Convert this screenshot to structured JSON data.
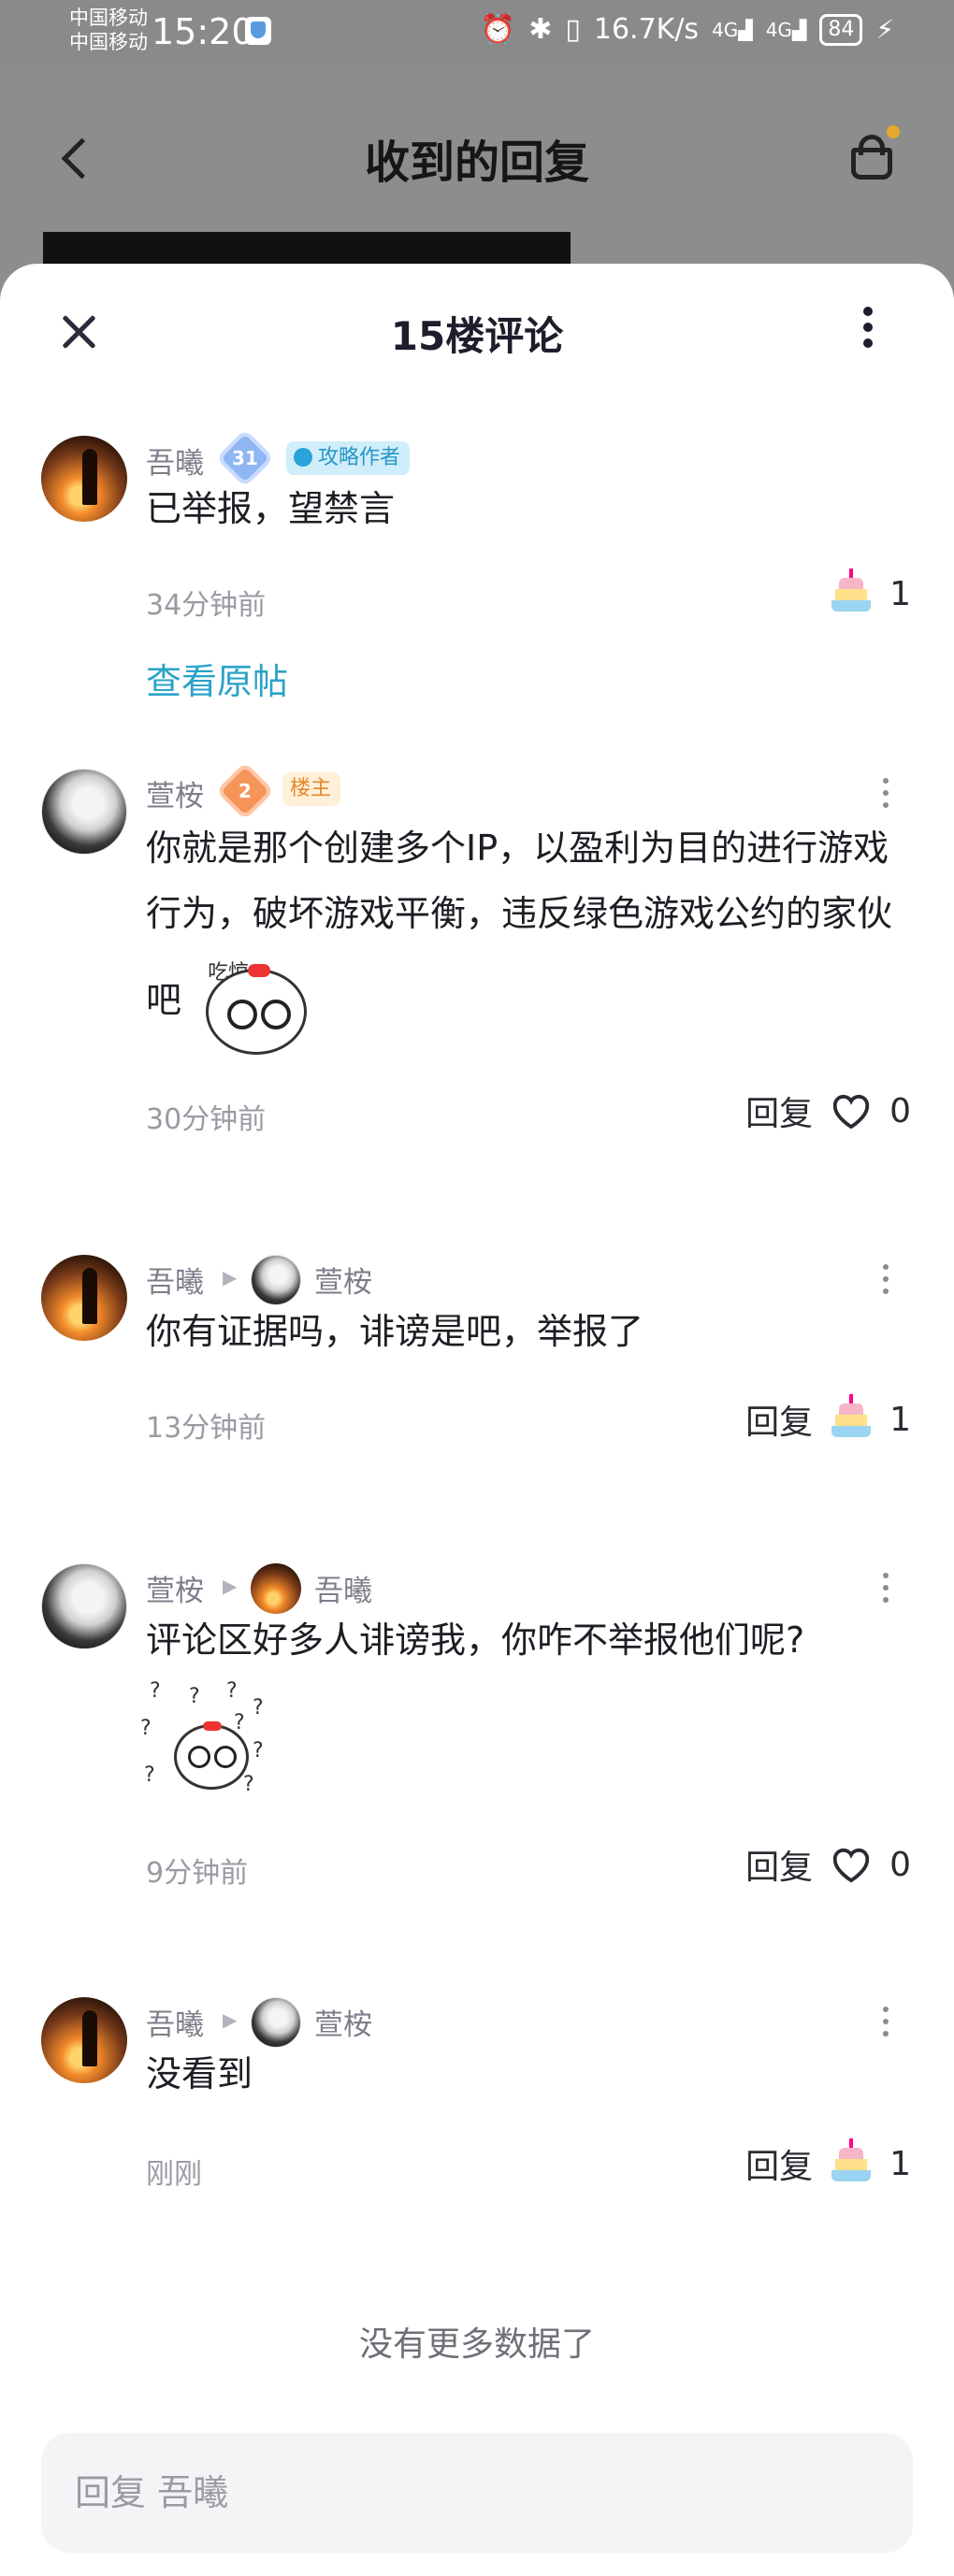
{
  "status_bar": {
    "carrier1": "中国移动",
    "carrier2": "中国移动",
    "time": "15:20",
    "net_speed": "16.7K/s",
    "signal1": "4G",
    "signal2": "4G",
    "battery": "84"
  },
  "page": {
    "title": "收到的回复"
  },
  "sheet": {
    "title": "15楼评论"
  },
  "main_comment": {
    "nickname": "吾曦",
    "level": "31",
    "tag": "攻略作者",
    "text": "已举报，望禁言",
    "time": "34分钟前",
    "cake_count": "1",
    "view_post_link": "查看原帖"
  },
  "replies": [
    {
      "nickname": "萱桉",
      "level": "2",
      "tag": "楼主",
      "text": "你就是那个创建多个IP，以盈利为目的进行游戏行为，破坏游戏平衡，违反绿色游戏公约的家伙吧",
      "sticker_text": "吃惊",
      "time": "30分钟前",
      "reply_label": "回复",
      "like_count": "0"
    },
    {
      "nickname": "吾曦",
      "reply_to": "萱桉",
      "text": "你有证据吗，诽谤是吧，举报了",
      "time": "13分钟前",
      "reply_label": "回复",
      "cake_count": "1"
    },
    {
      "nickname": "萱桉",
      "reply_to": "吾曦",
      "text": "评论区好多人诽谤我，你咋不举报他们呢?",
      "time": "9分钟前",
      "reply_label": "回复",
      "like_count": "0"
    },
    {
      "nickname": "吾曦",
      "reply_to": "萱桉",
      "text": "没看到",
      "time": "刚刚",
      "reply_label": "回复",
      "cake_count": "1"
    }
  ],
  "footer": {
    "no_more": "没有更多数据了",
    "reply_placeholder": "回复 吾曦"
  },
  "icons": {
    "back": "back-arrow-icon",
    "basket": "shopping-basket-icon",
    "close": "close-icon",
    "more": "more-vertical-icon",
    "heart": "heart-icon",
    "cake": "cake-icon"
  },
  "colors": {
    "link": "#2aa3c8",
    "overlay": "#8d8d8d",
    "tag_blue_text": "#2996c9",
    "tag_yellow_text": "#e5882c"
  }
}
